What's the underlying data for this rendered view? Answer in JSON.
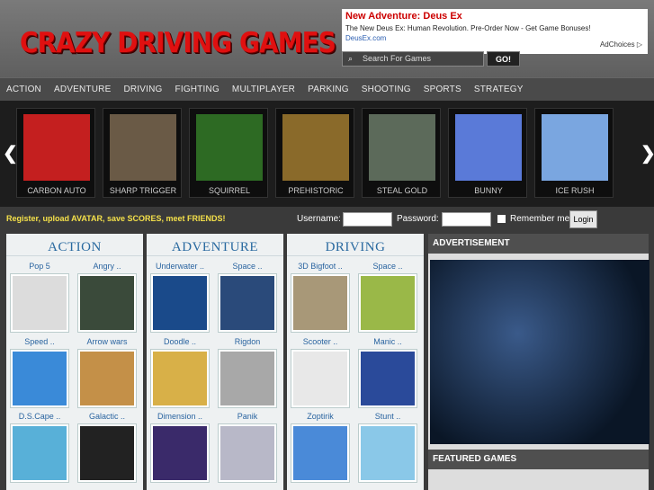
{
  "header": {
    "logo": "CRAZY DRIVING GAMES",
    "ad_title": "New Adventure: Deus Ex",
    "ad_text": "The New Deus Ex: Human Revolution. Pre-Order Now - Get Game Bonuses!",
    "ad_url": "DeusEx.com",
    "adchoices": "AdChoices ▷",
    "search_placeholder": "Search For Games",
    "go_label": "GO!"
  },
  "nav": [
    "ACTION",
    "ADVENTURE",
    "DRIVING",
    "FIGHTING",
    "MULTIPLAYER",
    "PARKING",
    "SHOOTING",
    "SPORTS",
    "STRATEGY"
  ],
  "carousel": [
    {
      "label": "CARBON AUTO",
      "color": "#c41f1f"
    },
    {
      "label": "SHARP TRIGGER",
      "color": "#6a5a46"
    },
    {
      "label": "SQUIRREL",
      "color": "#2d6a23"
    },
    {
      "label": "PREHISTORIC",
      "color": "#8a6a2a"
    },
    {
      "label": "STEAL GOLD",
      "color": "#5c6a5a"
    },
    {
      "label": "BUNNY",
      "color": "#5a7ad8"
    },
    {
      "label": "ICE RUSH",
      "color": "#7aa6e0"
    }
  ],
  "register": {
    "message": "Register, upload AVATAR, save SCORES, meet FRIENDS!",
    "username_label": "Username:",
    "password_label": "Password:",
    "remember_label": "Remember me",
    "login_label": "Login"
  },
  "columns": [
    {
      "title": "ACTION",
      "games": [
        {
          "name": "Pop 5",
          "color": "#dcdcdc"
        },
        {
          "name": "Angry ..",
          "color": "#3a4a3a"
        },
        {
          "name": "Speed ..",
          "color": "#3a8ad8"
        },
        {
          "name": "Arrow wars",
          "color": "#c49048"
        },
        {
          "name": "D.S.Cape ..",
          "color": "#58b0d8"
        },
        {
          "name": "Galactic ..",
          "color": "#222222"
        }
      ]
    },
    {
      "title": "ADVENTURE",
      "games": [
        {
          "name": "Underwater ..",
          "color": "#1a4a8a"
        },
        {
          "name": "Space ..",
          "color": "#2a4a7a"
        },
        {
          "name": "Doodle ..",
          "color": "#d8b048"
        },
        {
          "name": "Rigdon",
          "color": "#a8a8a8"
        },
        {
          "name": "Dimension ..",
          "color": "#3a2a6a"
        },
        {
          "name": "Panik",
          "color": "#b8b8c8"
        }
      ]
    },
    {
      "title": "DRIVING",
      "games": [
        {
          "name": "3D Bigfoot ..",
          "color": "#a89878"
        },
        {
          "name": "Space ..",
          "color": "#9ab848"
        },
        {
          "name": "Scooter ..",
          "color": "#e8e8e8"
        },
        {
          "name": "Manic ..",
          "color": "#2a4a9a"
        },
        {
          "name": "Zoptirik",
          "color": "#4a8ad8"
        },
        {
          "name": "Stunt ..",
          "color": "#8ac8e8"
        }
      ]
    }
  ],
  "sidebar": {
    "ad_heading": "ADVERTISEMENT",
    "featured_heading": "FEATURED GAMES"
  }
}
